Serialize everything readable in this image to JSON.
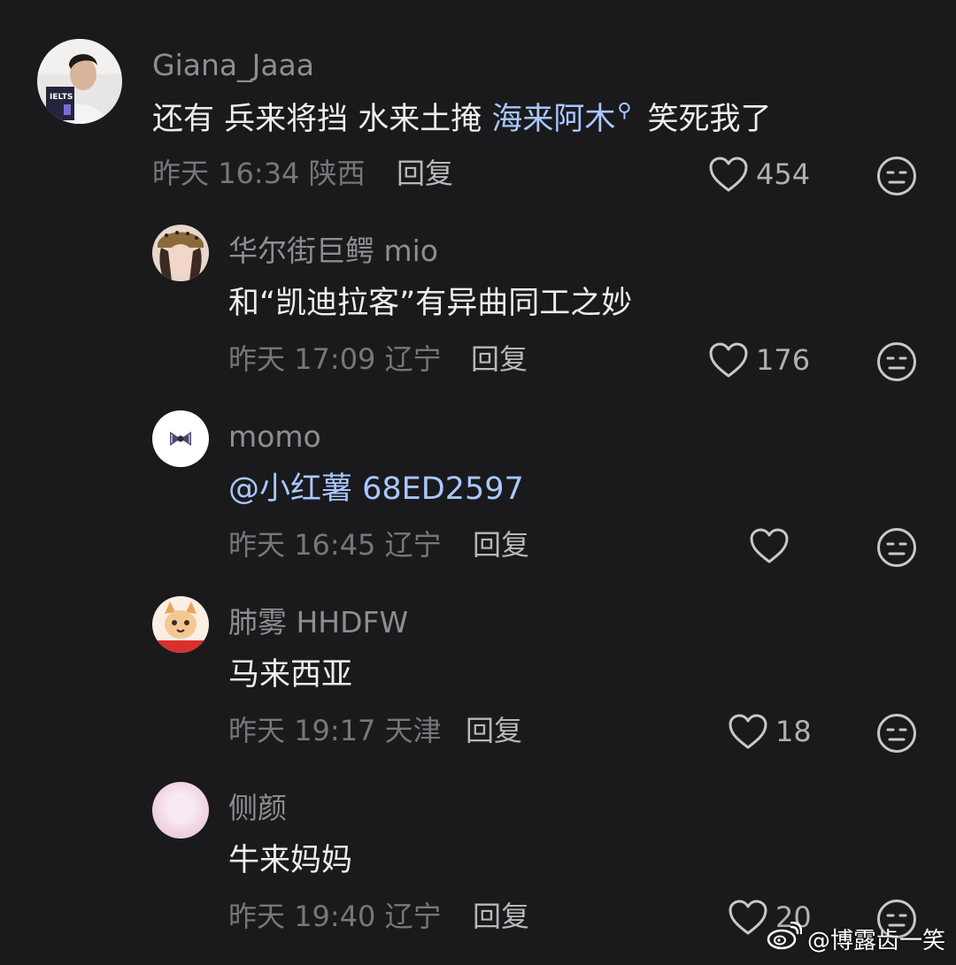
{
  "comments": [
    {
      "username": "Giana_Jaaa",
      "content_prefix": "还有 兵来将挡 水来土掩 ",
      "content_link": "海来阿木",
      "content_suffix": "笑死我了",
      "date": "昨天",
      "time": "16:34",
      "location": "陕西",
      "reply_label": "回复",
      "likes": "454"
    },
    {
      "username": "华尔街巨鳄 mio",
      "content": "和“凯迪拉客”有异曲同工之妙",
      "date": "昨天",
      "time": "17:09",
      "location": "辽宁",
      "reply_label": "回复",
      "likes": "176"
    },
    {
      "username": "momo",
      "content": "@小红薯 68ED2597",
      "date": "昨天",
      "time": "16:45",
      "location": "辽宁",
      "reply_label": "回复",
      "likes": ""
    },
    {
      "username": "肺雾 HHDFW",
      "content": "马来西亚",
      "date": "昨天",
      "time": "19:17",
      "location": "天津",
      "reply_label": "回复",
      "likes": "18"
    },
    {
      "username": "侧颜",
      "content": "牛来妈妈",
      "date": "昨天",
      "time": "19:40",
      "location": "辽宁",
      "reply_label": "回复",
      "likes": "20"
    }
  ],
  "avatar_badge_text": "IELTS",
  "watermark": "@博露齿一笑",
  "icons": {
    "like": "heart-outline-icon",
    "dislike": "neutral-face-icon",
    "link": "search-icon"
  },
  "colors": {
    "background": "#1a1a1d",
    "link": "#a9c8ff",
    "username": "#8d8d92"
  }
}
